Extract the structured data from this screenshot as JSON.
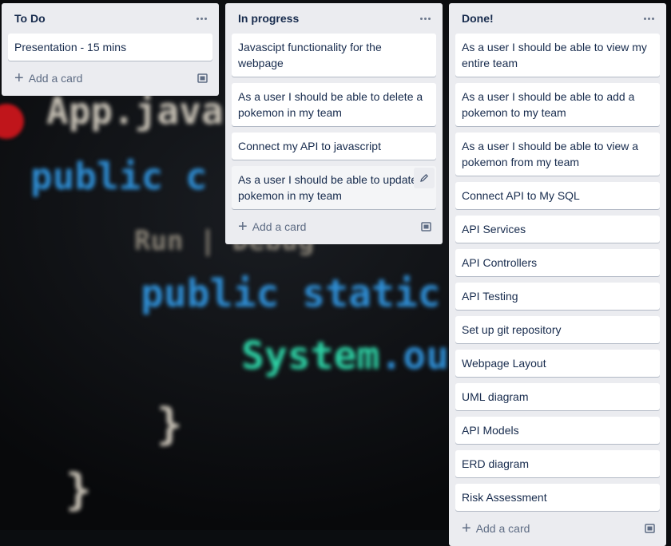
{
  "background_code": {
    "app": "App.java",
    "line1": "public c",
    "run": "Run | Debug",
    "line2": "public static",
    "line3a": "System",
    "line3b": ".ou",
    "brace1": "}",
    "brace2": "}"
  },
  "lists": [
    {
      "title": "To Do",
      "cards": [
        "Presentation - 15 mins"
      ],
      "add_label": "Add a card"
    },
    {
      "title": "In progress",
      "cards": [
        "Javascipt functionality for the webpage",
        "As a user I should be able to delete a pokemon in my team",
        "Connect my API to javascript",
        "As a user I should be able to update pokemon in my team"
      ],
      "add_label": "Add a card"
    },
    {
      "title": "Done!",
      "cards": [
        "As a user I should be able to view my entire team",
        "As a user I should be able to add a pokemon to my team",
        "As a user I should be able to view a pokemon from my team",
        "Connect API to My SQL",
        "API Services",
        "API Controllers",
        "API Testing",
        "Set up git repository",
        "Webpage Layout",
        "UML diagram",
        "API Models",
        "ERD diagram",
        "Risk Assessment"
      ],
      "add_label": "Add a card"
    }
  ],
  "icons": {
    "list_menu": "more-horizontal-icon",
    "add": "plus-icon",
    "template": "card-template-icon",
    "edit": "pencil-icon"
  }
}
